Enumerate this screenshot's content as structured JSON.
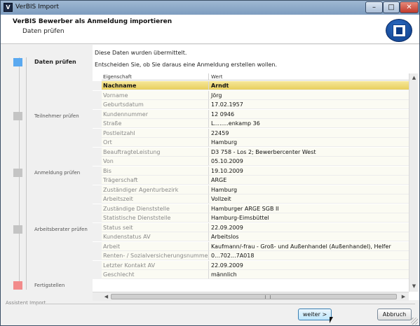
{
  "window": {
    "title": "VerBIS Import",
    "app_icon": "verbis-app-icon",
    "controls": {
      "minimize": "–",
      "maximize": "□",
      "close": "✕"
    }
  },
  "header": {
    "title": "VerBIS Bewerber als Anmeldung importieren",
    "subtitle": "Daten prüfen",
    "logo_icon": "person-at-desk-logo-icon"
  },
  "steps": [
    {
      "label": "Daten prüfen",
      "color": "#5aa9f0",
      "active": true
    },
    {
      "label": "Teilnehmer prüfen",
      "color": "#c4c4c4",
      "active": false
    },
    {
      "label": "Anmeldung prüfen",
      "color": "#c4c4c4",
      "active": false
    },
    {
      "label": "Arbeitsberater prüfen",
      "color": "#c4c4c4",
      "active": false
    },
    {
      "label": "Fertigstellen",
      "color": "#f28b8b",
      "active": false
    }
  ],
  "main": {
    "intro_line1": "Diese Daten wurden übermittelt.",
    "intro_line2": "Entscheiden Sie, ob Sie daraus eine Anmeldung erstellen wollen.",
    "table": {
      "col_key": "Eigenschaft",
      "col_value": "Wert",
      "selected_row": 0,
      "rows": [
        {
          "key": "Nachname",
          "value": "Arndt"
        },
        {
          "key": "Vorname",
          "value": "Jörg"
        },
        {
          "key": "Geburtsdatum",
          "value": "17.02.1957"
        },
        {
          "key": "Kundennummer",
          "value": "12       0946"
        },
        {
          "key": "Straße",
          "value": "L........enkamp 36"
        },
        {
          "key": "Postleitzahl",
          "value": "22459"
        },
        {
          "key": "Ort",
          "value": "Hamburg"
        },
        {
          "key": "BeauftragteLeistung",
          "value": "D3  758 - Los 2; Bewerbercenter West"
        },
        {
          "key": "Von",
          "value": "05.10.2009"
        },
        {
          "key": "Bis",
          "value": "19.10.2009"
        },
        {
          "key": "Trägerschaft",
          "value": "ARGE"
        },
        {
          "key": "Zuständiger Agenturbezirk",
          "value": "Hamburg"
        },
        {
          "key": "Arbeitszeit",
          "value": "Vollzeit"
        },
        {
          "key": "Zuständige Dienststelle",
          "value": "Hamburger ARGE SGB II"
        },
        {
          "key": "Statistische Dienststelle",
          "value": "Hamburg-Eimsbüttel"
        },
        {
          "key": "Status seit",
          "value": "22.09.2009"
        },
        {
          "key": "Kundenstatus AV",
          "value": "Arbeitslos"
        },
        {
          "key": "Arbeit",
          "value": "Kaufmann/-frau - Groß- und Außenhandel (Außenhandel), Helfer"
        },
        {
          "key": "Renten- / Sozialversicherungsnummer",
          "value": "0...702...7A018"
        },
        {
          "key": "Letzter Kontakt AV",
          "value": "22.09.2009"
        },
        {
          "key": "Geschlecht",
          "value": "männlich"
        }
      ]
    }
  },
  "footer": {
    "group_label": "Assistent Import",
    "next_button": "weiter >",
    "cancel_button": "Abbruch"
  }
}
